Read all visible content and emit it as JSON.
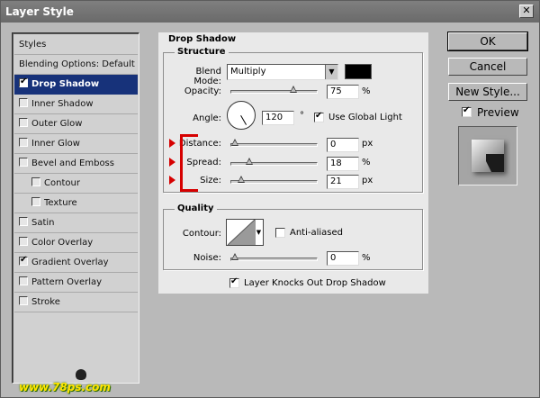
{
  "window": {
    "title": "Layer Style"
  },
  "styles_list": {
    "header": "Styles",
    "items": [
      {
        "label": "Blending Options: Default",
        "checkbox": false,
        "checked": false,
        "selected": false,
        "indent": false
      },
      {
        "label": "Drop Shadow",
        "checkbox": true,
        "checked": true,
        "selected": true,
        "indent": false
      },
      {
        "label": "Inner Shadow",
        "checkbox": true,
        "checked": false,
        "selected": false,
        "indent": false
      },
      {
        "label": "Outer Glow",
        "checkbox": true,
        "checked": false,
        "selected": false,
        "indent": false
      },
      {
        "label": "Inner Glow",
        "checkbox": true,
        "checked": false,
        "selected": false,
        "indent": false
      },
      {
        "label": "Bevel and Emboss",
        "checkbox": true,
        "checked": false,
        "selected": false,
        "indent": false
      },
      {
        "label": "Contour",
        "checkbox": true,
        "checked": false,
        "selected": false,
        "indent": true
      },
      {
        "label": "Texture",
        "checkbox": true,
        "checked": false,
        "selected": false,
        "indent": true
      },
      {
        "label": "Satin",
        "checkbox": true,
        "checked": false,
        "selected": false,
        "indent": false
      },
      {
        "label": "Color Overlay",
        "checkbox": true,
        "checked": false,
        "selected": false,
        "indent": false
      },
      {
        "label": "Gradient Overlay",
        "checkbox": true,
        "checked": true,
        "selected": false,
        "indent": false
      },
      {
        "label": "Pattern Overlay",
        "checkbox": true,
        "checked": false,
        "selected": false,
        "indent": false
      },
      {
        "label": "Stroke",
        "checkbox": true,
        "checked": false,
        "selected": false,
        "indent": false
      }
    ]
  },
  "drop_shadow": {
    "title": "Drop Shadow",
    "structure_title": "Structure",
    "blend_mode_label": "Blend Mode:",
    "blend_mode_value": "Multiply",
    "shadow_color": "#000000",
    "opacity_label": "Opacity:",
    "opacity_value": "75",
    "opacity_level": 0.75,
    "angle_label": "Angle:",
    "angle_value": "120",
    "angle_unit": "°",
    "use_global_light_label": "Use Global Light",
    "use_global_light_checked": true,
    "distance_label": "Distance:",
    "distance_value": "0",
    "distance_level": 0,
    "spread_label": "Spread:",
    "spread_value": "18",
    "spread_level": 0.18,
    "size_label": "Size:",
    "size_value": "21",
    "size_level": 0.08,
    "px_unit": "px",
    "percent_unit": "%",
    "quality_title": "Quality",
    "contour_label": "Contour:",
    "anti_aliased_label": "Anti-aliased",
    "anti_aliased_checked": false,
    "noise_label": "Noise:",
    "noise_value": "0",
    "noise_level": 0,
    "knockout_label": "Layer Knocks Out Drop Shadow",
    "knockout_checked": true
  },
  "buttons": {
    "ok": "OK",
    "cancel": "Cancel",
    "new_style": "New Style..."
  },
  "preview": {
    "label": "Preview",
    "checked": true
  },
  "watermark": {
    "text": "www.78ps.com"
  },
  "accent_colors": {
    "selection": "#17327a",
    "annotation": "#d60000"
  }
}
